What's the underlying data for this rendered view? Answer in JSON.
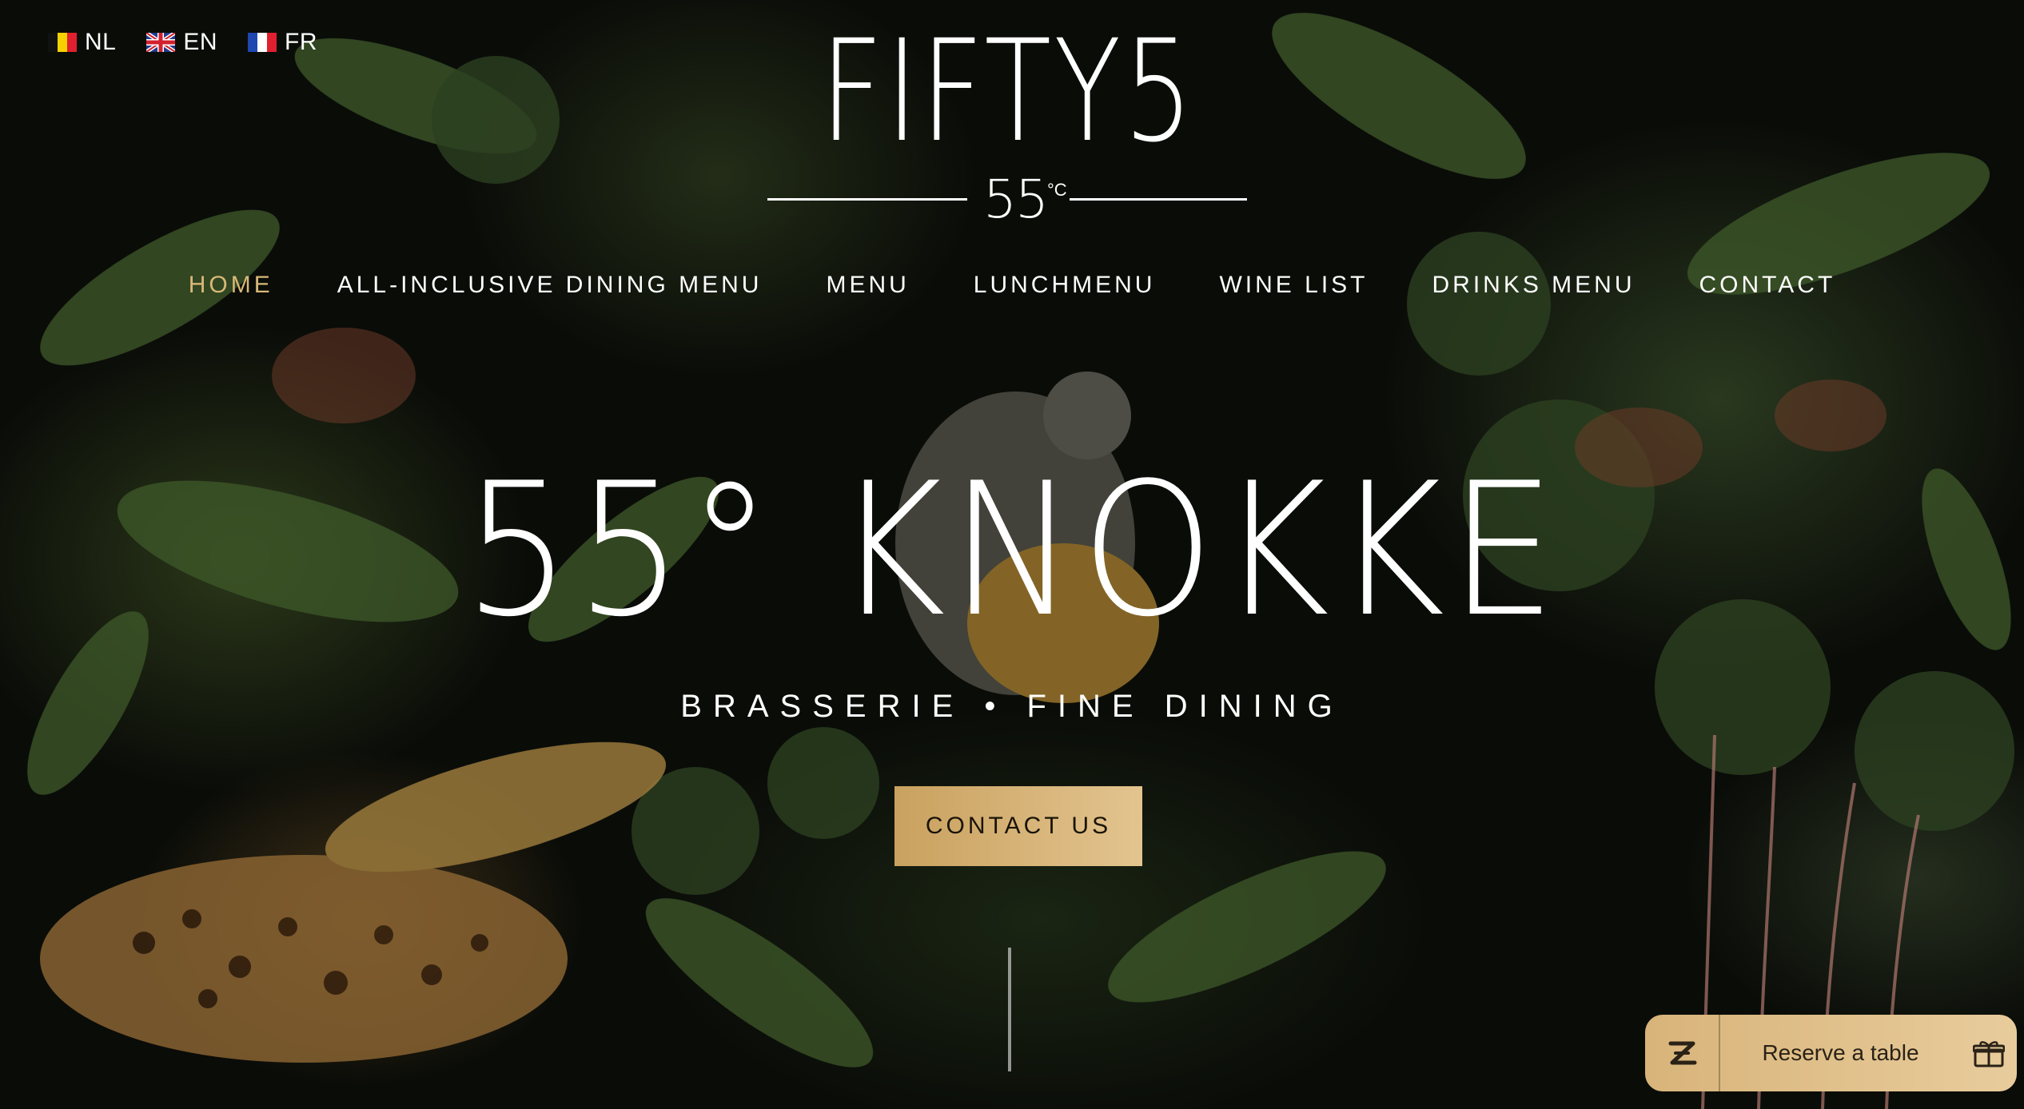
{
  "languages": [
    {
      "code": "NL",
      "flag": "belgium-flag"
    },
    {
      "code": "EN",
      "flag": "uk-flag"
    },
    {
      "code": "FR",
      "flag": "france-flag"
    }
  ],
  "logo": {
    "word": "FIFTY5",
    "sub": "55",
    "unit": "°C"
  },
  "nav": {
    "items": [
      {
        "label": "HOME",
        "active": true
      },
      {
        "label": "ALL-INCLUSIVE DINING MENU",
        "active": false
      },
      {
        "label": "MENU",
        "active": false
      },
      {
        "label": "LUNCHMENU",
        "active": false
      },
      {
        "label": "WINE LIST",
        "active": false
      },
      {
        "label": "DRINKS MENU",
        "active": false
      },
      {
        "label": "CONTACT",
        "active": false
      }
    ]
  },
  "hero": {
    "title": "55° KNOKKE",
    "subtitle": "BRASSERIE • FINE DINING",
    "cta_label": "CONTACT US"
  },
  "reserve_widget": {
    "label": "Reserve a table",
    "logo_icon": "z-logo-icon",
    "gift_icon": "gift-icon"
  },
  "colors": {
    "accent_gold": "#d8b878",
    "cta_gold_start": "#c9a15f",
    "cta_gold_end": "#e3c48f",
    "background": "#0a0c08"
  }
}
